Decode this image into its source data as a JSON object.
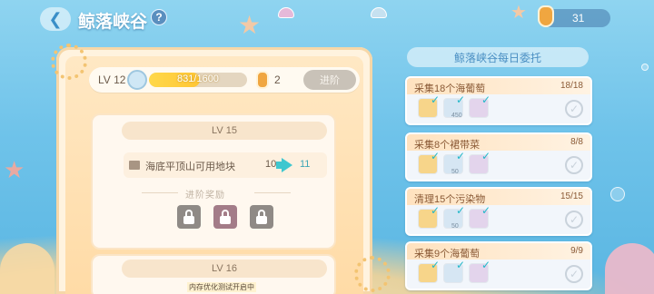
{
  "header": {
    "back_glyph": "❮",
    "title": "鲸落峡谷",
    "help_glyph": "?",
    "currency_icon": "seahorse-icon",
    "currency_value": "31"
  },
  "level": {
    "label": "LV 12",
    "progress_text": "831/1600",
    "progress_fraction": 0.519,
    "token_icon": "seahorse-icon",
    "token_count": "2",
    "advance_label": "进阶"
  },
  "upgrade_card": {
    "level_label": "LV 15",
    "row_label": "海底平顶山可用地块",
    "from_value": "10",
    "to_value": "11",
    "reward_label": "进阶奖励",
    "reward_locks": [
      "lock-icon",
      "lock-icon",
      "lock-icon"
    ]
  },
  "next_card": {
    "level_label": "LV 16"
  },
  "tasks": {
    "header": "鲸落峡谷每日委托",
    "items": [
      {
        "title": "采集18个海葡萄",
        "count": "18/18",
        "sub": "450",
        "done_glyph": "✓"
      },
      {
        "title": "采集8个裙带菜",
        "count": "8/8",
        "sub": "50",
        "done_glyph": "✓"
      },
      {
        "title": "清理15个污染物",
        "count": "15/15",
        "sub": "50",
        "done_glyph": "✓"
      },
      {
        "title": "采集9个海葡萄",
        "count": "9/9",
        "sub": "",
        "done_glyph": "✓"
      }
    ]
  },
  "footer": {
    "notice": "内存优化测试开启中"
  },
  "colors": {
    "accent": "#3fc7cf",
    "panel": "#ffe8c4",
    "ocean": "#6fc3ea"
  }
}
